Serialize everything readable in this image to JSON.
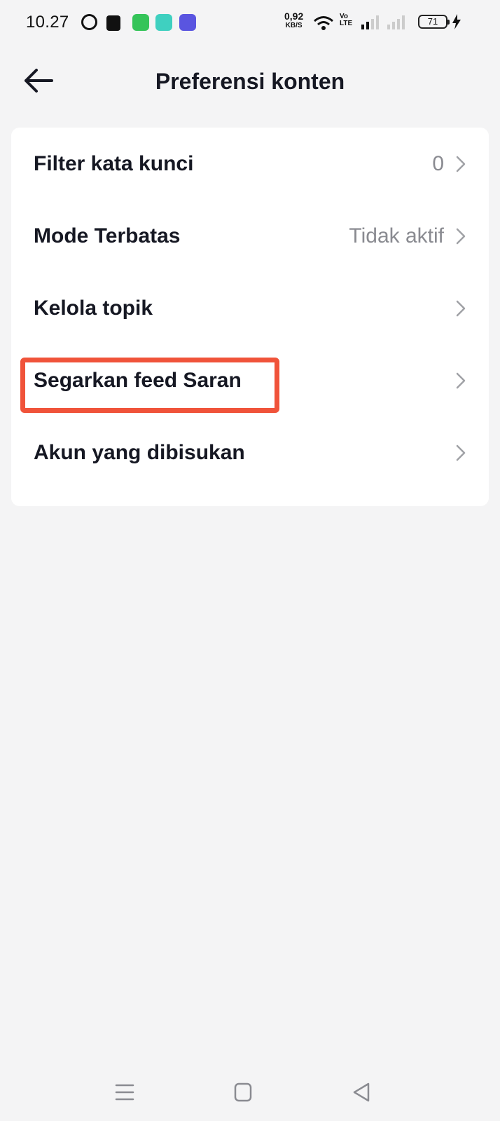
{
  "status_bar": {
    "time": "10.27",
    "net_speed_value": "0,92",
    "net_speed_unit": "KB/S",
    "volte_line1": "Vo",
    "volte_line2": "LTE",
    "battery": "71",
    "icons": [
      "whatsapp-icon",
      "shopee-icon",
      "green-app-icon",
      "teal-app-icon",
      "purple-app-icon",
      "wifi-icon",
      "signal-icon",
      "battery-icon",
      "charging-icon"
    ]
  },
  "header": {
    "title": "Preferensi konten",
    "back_icon": "arrow-left-icon"
  },
  "menu": {
    "items": [
      {
        "label": "Filter kata kunci",
        "value": "0"
      },
      {
        "label": "Mode Terbatas",
        "value": "Tidak aktif"
      },
      {
        "label": "Kelola topik",
        "value": ""
      },
      {
        "label": "Segarkan feed Saran",
        "value": "",
        "highlighted": true
      },
      {
        "label": "Akun yang dibisukan",
        "value": ""
      }
    ]
  },
  "nav_bar": {
    "icons": [
      "menu-icon",
      "home-icon",
      "back-triangle-icon"
    ]
  },
  "colors": {
    "background": "#f4f4f5",
    "card": "#ffffff",
    "text_primary": "#161823",
    "text_secondary": "#8a8b91",
    "highlight": "#f0533a"
  }
}
